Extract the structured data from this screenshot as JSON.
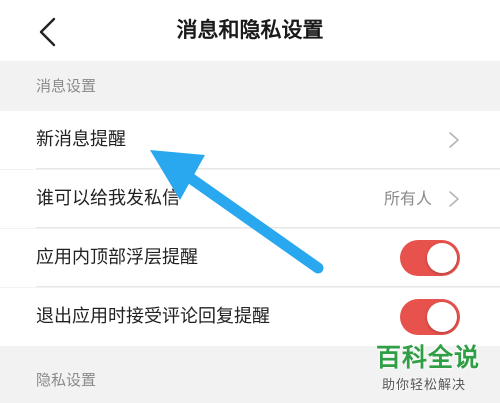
{
  "header": {
    "title": "消息和隐私设置",
    "back_icon": "chevron-left-icon"
  },
  "sections": {
    "message": {
      "title": "消息设置",
      "rows": [
        {
          "label": "新消息提醒",
          "control": "chevron"
        },
        {
          "label": "谁可以给我发私信",
          "value": "所有人",
          "control": "chevron"
        },
        {
          "label": "应用内顶部浮层提醒",
          "control": "toggle",
          "on": true
        },
        {
          "label": "退出应用时接受评论回复提醒",
          "control": "toggle",
          "on": true
        }
      ]
    },
    "privacy": {
      "title": "隐私设置"
    }
  },
  "watermark": {
    "title": "百科全说",
    "subtitle": "助你轻松解决"
  },
  "colors": {
    "accent": "#e8524d",
    "arrow": "#29a8f0",
    "watermark_green": "#2f9e44"
  }
}
